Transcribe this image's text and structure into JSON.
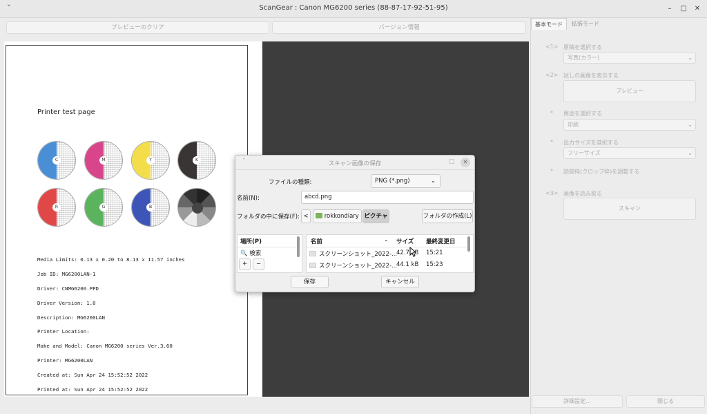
{
  "window": {
    "title": "ScanGear : Canon MG6200 series (88-87-17-92-51-95)",
    "chevron": "˅",
    "minimize": "–",
    "maximize": "□",
    "close": "✕"
  },
  "toolbar": {
    "clear_preview": "プレビューのクリア",
    "version_info": "バージョン情報"
  },
  "testpage": {
    "title": "Printer test page",
    "circles": [
      {
        "label": "C",
        "color": "#4a8fd6"
      },
      {
        "label": "M",
        "color": "#d9458b"
      },
      {
        "label": "Y",
        "color": "#f3dd4b"
      },
      {
        "label": "K",
        "color": "#3a3535"
      },
      {
        "label": "R",
        "color": "#e04848"
      },
      {
        "label": "G",
        "color": "#5cb35e"
      },
      {
        "label": "B",
        "color": "#3e55b8"
      }
    ],
    "info": [
      "Media Limits: 0.13 x 0.20 to 8.13 x 11.57 inches",
      "Job ID: MG6200LAN-1",
      "Driver: CNMG6200.PPD",
      "Driver Version: 1.0",
      "Description: MG6200LAN",
      "Printer Location:",
      "Make and Model: Canon MG6200 series Ver.3.60",
      "Printer: MG6200LAN",
      "Created at: Sun Apr 24 15:52:52 2022",
      "Printed at: Sun Apr 24 15:52:52 2022"
    ]
  },
  "right_panel": {
    "tab_basic": "基本モード",
    "tab_advanced": "拡張モード",
    "step1": "<1>",
    "select_source_label": "原稿を選択する",
    "source_value": "写真(カラー)",
    "step2": "<2>",
    "display_preview_label": "試しの画像を表示する",
    "preview_button": "プレビュー",
    "star1": "*",
    "select_purpose_label": "用途を選択する",
    "purpose_value": "印刷",
    "star2": "*",
    "output_size_label": "出力サイズを選択する",
    "output_size_value": "フリーサイズ",
    "star3": "*",
    "crop_label": "読取枠(クロップ枠)を調整する",
    "step3": "<3>",
    "scan_label": "画像を読み取る",
    "scan_button": "スキャン",
    "detail_button": "詳細設定...",
    "close_button": "閉じる"
  },
  "dialog": {
    "title": "スキャン画像の保存",
    "file_type_label": "ファイルの種類:",
    "file_type_value": "PNG (*.png)",
    "name_label": "名前(N):",
    "name_value": "abcd.png",
    "save_in_label": "フォルダの中に保存(F):",
    "back": "<",
    "crumb_home": "rokkondiary",
    "crumb_current": "ピクチャ",
    "create_folder": "フォルダの作成(L)",
    "places_header": "場所(P)",
    "places_search": "検索",
    "add": "+",
    "remove": "−",
    "col_name": "名前",
    "col_size": "サイズ",
    "col_modified": "最終変更日",
    "files": [
      {
        "name": "スクリーンショット_2022-...",
        "size": "42.7 kB",
        "modified": "15:21"
      },
      {
        "name": "スクリーンショット_2022-...",
        "size": "44.1 kB",
        "modified": "15:23"
      }
    ],
    "save_button": "保存",
    "cancel_button": "キャンセル"
  }
}
